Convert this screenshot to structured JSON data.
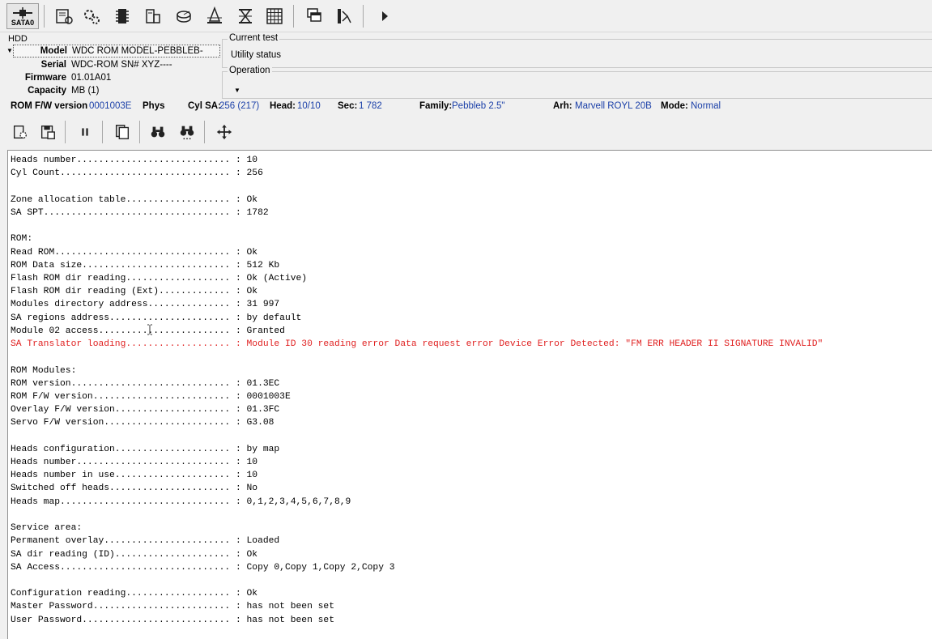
{
  "toolbar": {
    "port_label": "SATA0",
    "icons": [
      "sata-port-icon",
      "hdd-settings-icon",
      "gears-icon",
      "chip-icon",
      "modules-icon",
      "disk-icon",
      "heads-icon",
      "hourglass-icon",
      "grid-icon",
      "windows-icon",
      "user-book-icon",
      "play-icon"
    ]
  },
  "hdd": {
    "legend": "HDD",
    "model_label": "Model",
    "model": "WDC ROM MODEL-PEBBLEB-",
    "serial_label": "Serial",
    "serial": "WDC-ROM SN# XYZ----",
    "firmware_label": "Firmware",
    "firmware": "01.01A01",
    "capacity_label": "Capacity",
    "capacity": "MB (1)"
  },
  "current_test": {
    "legend": "Current test",
    "value": "Utility status"
  },
  "operation": {
    "legend": "Operation"
  },
  "status": {
    "romfw_label": "ROM F/W version",
    "romfw": "0001003E",
    "phys_label": "Phys",
    "cylsa_label": "Cyl SA:",
    "cylsa": "256 (217)",
    "head_label": "Head:",
    "head": "10/10",
    "sec_label": "Sec:",
    "sec": "1 782",
    "family_label": "Family:",
    "family": "Pebbleb 2.5\"",
    "arh_label": "Arh:",
    "arh": "Marvell ROYL 20B",
    "mode_label": "Mode:",
    "mode": "Normal"
  },
  "colors": {
    "error": "#e02020",
    "value_blue": "#1a3fa8"
  },
  "log": {
    "lines": [
      {
        "text": "Heads number............................ : 10"
      },
      {
        "text": "Cyl Count............................... : 256"
      },
      {
        "text": ""
      },
      {
        "text": "Zone allocation table................... : Ok"
      },
      {
        "text": "SA SPT.................................. : 1782"
      },
      {
        "text": ""
      },
      {
        "text": "ROM:"
      },
      {
        "text": "Read ROM................................ : Ok"
      },
      {
        "text": "ROM Data size........................... : 512 Kb"
      },
      {
        "text": "Flash ROM dir reading................... : Ok (Active)"
      },
      {
        "text": "Flash ROM dir reading (Ext)............. : Ok"
      },
      {
        "text": "Modules directory address............... : 31 997"
      },
      {
        "text": "SA regions address...................... : by default"
      },
      {
        "text": "Module 02 access........................ : Granted"
      },
      {
        "text": "SA Translator loading................... : Module ID 30 reading error Data request error Device Error Detected: \"FM ERR HEADER II SIGNATURE INVALID\"",
        "error": true
      },
      {
        "text": ""
      },
      {
        "text": "ROM Modules:"
      },
      {
        "text": "ROM version............................. : 01.3EC"
      },
      {
        "text": "ROM F/W version......................... : 0001003E"
      },
      {
        "text": "Overlay F/W version..................... : 01.3FC"
      },
      {
        "text": "Servo F/W version....................... : G3.08"
      },
      {
        "text": ""
      },
      {
        "text": "Heads configuration..................... : by map"
      },
      {
        "text": "Heads number............................ : 10"
      },
      {
        "text": "Heads number in use..................... : 10"
      },
      {
        "text": "Switched off heads...................... : No"
      },
      {
        "text": "Heads map............................... : 0,1,2,3,4,5,6,7,8,9"
      },
      {
        "text": ""
      },
      {
        "text": "Service area:"
      },
      {
        "text": "Permanent overlay....................... : Loaded"
      },
      {
        "text": "SA dir reading (ID)..................... : Ok"
      },
      {
        "text": "SA Access............................... : Copy 0,Copy 1,Copy 2,Copy 3"
      },
      {
        "text": ""
      },
      {
        "text": "Configuration reading................... : Ok"
      },
      {
        "text": "Master Password......................... : has not been set"
      },
      {
        "text": "User Password........................... : has not been set"
      }
    ]
  }
}
